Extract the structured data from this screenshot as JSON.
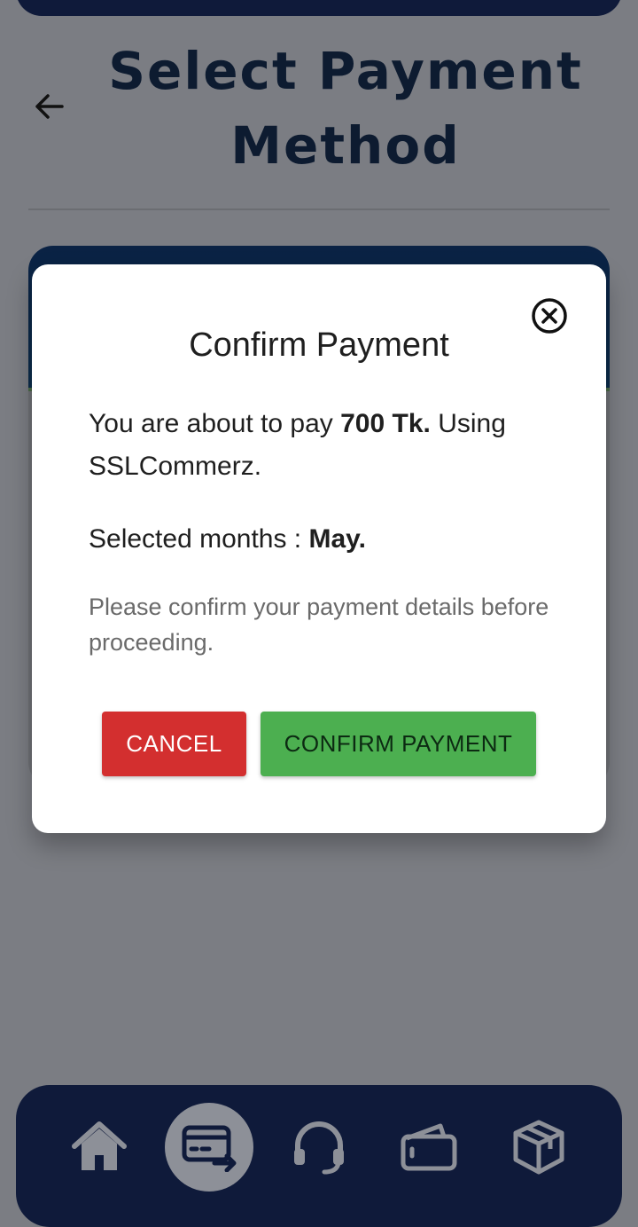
{
  "header": {
    "title": "Select Payment Method",
    "back_icon": "arrow-left-icon"
  },
  "dialog": {
    "title": "Confirm Payment",
    "close_icon": "close-circle-icon",
    "message_prefix": "You are about to pay ",
    "amount": "700 Tk.",
    "message_suffix": " Using SSLCommerz.",
    "months_label": "Selected months : ",
    "months_value": "May.",
    "note": "Please confirm your payment details before proceeding.",
    "cancel_label": "CANCEL",
    "confirm_label": "CONFIRM PAYMENT"
  },
  "colors": {
    "nav_background": "#0f1a3a",
    "cancel": "#d32f2f",
    "confirm": "#4caf50",
    "overlay": "#7b7d83"
  },
  "nav": [
    {
      "icon": "home-icon",
      "active": false
    },
    {
      "icon": "card-transfer-icon",
      "active": true
    },
    {
      "icon": "headset-icon",
      "active": false
    },
    {
      "icon": "wallet-icon",
      "active": false
    },
    {
      "icon": "package-icon",
      "active": false
    }
  ]
}
